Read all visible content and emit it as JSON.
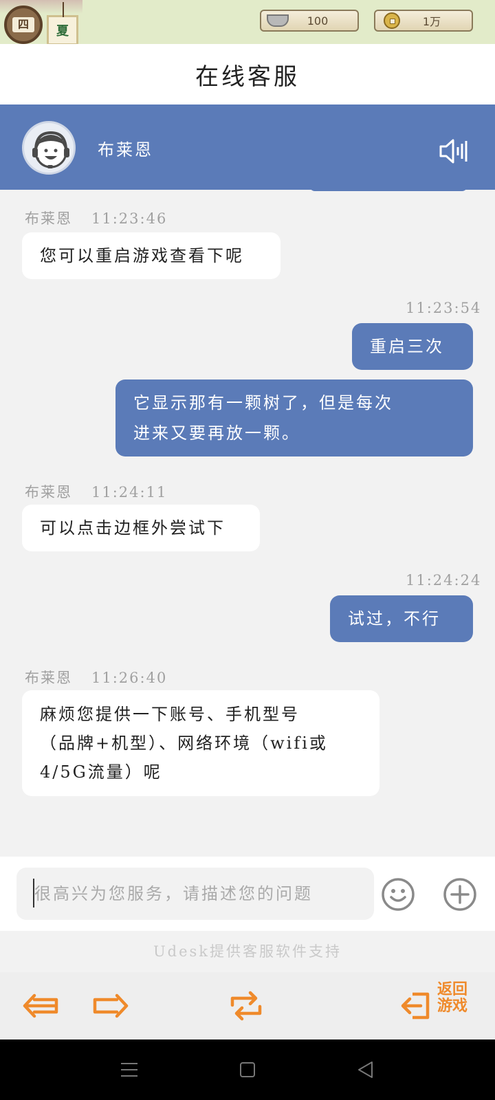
{
  "game_bar": {
    "season_badge": "四",
    "season_card": "夏",
    "silver": {
      "icon": "silver-ingot-icon",
      "value": "100"
    },
    "copper": {
      "icon": "copper-coin-icon",
      "value": "1万"
    }
  },
  "page": {
    "title": "在线客服"
  },
  "agent": {
    "name": "布莱恩",
    "avatar_icon": "headset-agent-icon",
    "sound_icon": "speaker-icon"
  },
  "messages": [
    {
      "from": "agent",
      "name": "布莱恩",
      "time": "11:23:46",
      "lines": [
        "您可以重启游戏查看下呢"
      ]
    },
    {
      "from": "user",
      "time": "11:23:54",
      "lines": [
        "重启三次"
      ]
    },
    {
      "from": "user",
      "time": "",
      "lines": [
        "它显示那有一颗树了，但是每次",
        "进来又要再放一颗。"
      ]
    },
    {
      "from": "agent",
      "name": "布莱恩",
      "time": "11:24:11",
      "lines": [
        "可以点击边框外尝试下"
      ]
    },
    {
      "from": "user",
      "time": "11:24:24",
      "lines": [
        "试过，不行"
      ]
    },
    {
      "from": "agent",
      "name": "布莱恩",
      "time": "11:26:40",
      "lines": [
        "麻烦您提供一下账号、手机型号",
        "（品牌+机型）、网络环境（wifi或",
        "4/5G流量）呢"
      ]
    }
  ],
  "input": {
    "placeholder": "很高兴为您服务，请描述您的问题",
    "emoji_icon": "smiley-icon",
    "plus_icon": "plus-circle-icon"
  },
  "powered_by": "Udesk提供客服软件支持",
  "toolbar": {
    "back_icon": "arrow-left-icon",
    "forward_icon": "arrow-right-icon",
    "refresh_icon": "refresh-icon",
    "return_icon": "exit-icon",
    "return_label": "返回游戏"
  },
  "colors": {
    "accent_blue": "#5b7bb8",
    "toolbar_orange": "#ef8a2b"
  }
}
